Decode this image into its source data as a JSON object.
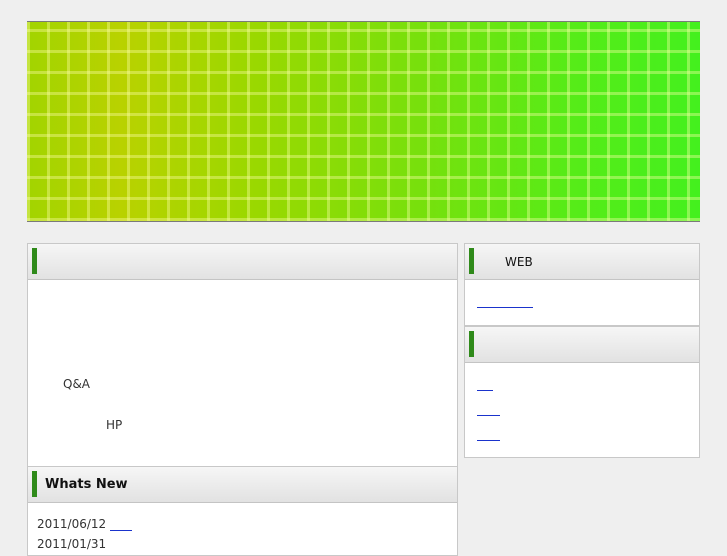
{
  "banner": {
    "colors": {
      "left": "#b9d200",
      "right": "#44f01e",
      "grid": "#ffffaa"
    }
  },
  "main_panel": {
    "header_title": "",
    "qa_label": "Q&A",
    "hp_label": "HP"
  },
  "news_panel": {
    "header_title": "Whats New",
    "items": [
      {
        "date": "2011/06/12",
        "link": ""
      },
      {
        "date": "2011/01/31",
        "link": ""
      }
    ]
  },
  "side_web": {
    "header_title": "WEB",
    "link": ""
  },
  "side_links": {
    "header_title": "",
    "links": [
      "",
      "",
      ""
    ]
  },
  "colors": {
    "accent_bar": "#2f8a1a",
    "link": "#1a33cc",
    "background": "#efefef"
  }
}
